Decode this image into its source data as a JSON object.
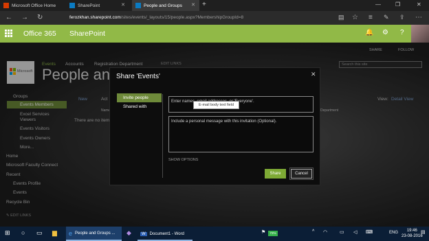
{
  "browser": {
    "tabs": [
      {
        "label": "Microsoft Office Home",
        "icon": "office-icon"
      },
      {
        "label": "SharePoint",
        "icon": "sharepoint-icon"
      },
      {
        "label": "People and Groups",
        "icon": "sharepoint-icon",
        "active": true
      }
    ],
    "url_host": "ferozkhan.sharepoint.com",
    "url_path": "/sites/events/_layouts/15/people.aspx?MembershipGroupId=8"
  },
  "suitebar": {
    "brand": "Office 365",
    "app": "SharePoint",
    "bg_color": "#91b947"
  },
  "site": {
    "share": "SHARE",
    "follow": "FOLLOW",
    "logo_text": "Microsoft",
    "topnav": [
      "Events",
      "Accounts",
      "Registration Department",
      "EDIT LINKS"
    ],
    "title": "People and G",
    "search_placeholder": "Search this site",
    "toolbar_new": "New",
    "toolbar_actions": "Act",
    "col_name": "Name",
    "empty_text": "There are no item",
    "department_col": "Department",
    "view_label": "View:",
    "view_value": "Detail View",
    "leftnav": {
      "groups": "Groups",
      "group_items": [
        "Events Members",
        "Excel Services Viewers",
        "Events Visitors",
        "Events Owners",
        "More..."
      ],
      "links": [
        "Home",
        "Microsoft Faculty Connect",
        "Recent",
        "Events Profile",
        "Events",
        "Recycle Bin"
      ],
      "edit_links": "EDIT LINKS"
    }
  },
  "dialog": {
    "title": "Share 'Events'",
    "tabs": [
      "Invite people",
      "Shared with"
    ],
    "names_placeholder": "Enter names, email addresses, or 'Everyone'.",
    "tooltip": "E-mail body text field",
    "message_placeholder": "Include a personal message with this invitation (Optional).",
    "show_options": "SHOW OPTIONS",
    "share_button": "Share",
    "cancel_button": "Cancel",
    "accent_color": "#7eaa35"
  },
  "taskbar": {
    "items": [
      {
        "label": "People and Groups ...",
        "icon": "edge-icon",
        "active": true
      },
      {
        "label": "Document1 - Word",
        "icon": "word-icon"
      }
    ],
    "battery": "72%",
    "language": "ENG",
    "time": "19:46",
    "date": "23-08-2016"
  }
}
